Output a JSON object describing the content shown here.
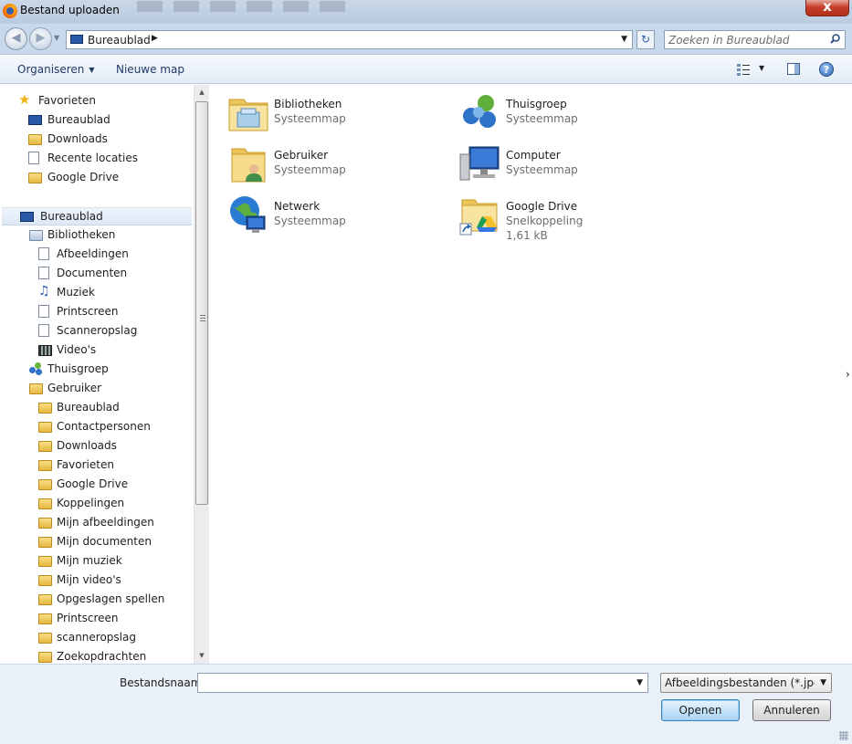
{
  "window": {
    "title": "Bestand uploaden",
    "close_label": "x"
  },
  "address": {
    "breadcrumb": "Bureaublad",
    "search_placeholder": "Zoeken in Bureaublad"
  },
  "toolbar": {
    "organize": "Organiseren",
    "new_folder": "Nieuwe map",
    "help": "?"
  },
  "nav": {
    "items": [
      {
        "label": "Favorieten",
        "icon": "star-icon",
        "level": 0
      },
      {
        "label": "Bureaublad",
        "icon": "desktop-icon",
        "level": 1
      },
      {
        "label": "Downloads",
        "icon": "downloads-folder-icon",
        "level": 1
      },
      {
        "label": "Recente locaties",
        "icon": "recent-places-icon",
        "level": 1
      },
      {
        "label": "Google Drive",
        "icon": "google-drive-folder-icon",
        "level": 1
      },
      {
        "label": "Bureaublad",
        "icon": "desktop-icon",
        "level": 0,
        "selected": true
      },
      {
        "label": "Bibliotheken",
        "icon": "libraries-icon",
        "level": 1
      },
      {
        "label": "Afbeeldingen",
        "icon": "pictures-icon",
        "level": 2
      },
      {
        "label": "Documenten",
        "icon": "documents-icon",
        "level": 2
      },
      {
        "label": "Muziek",
        "icon": "music-icon",
        "level": 2
      },
      {
        "label": "Printscreen",
        "icon": "library-icon",
        "level": 2
      },
      {
        "label": "Scanneropslag",
        "icon": "library-icon",
        "level": 2
      },
      {
        "label": "Video's",
        "icon": "videos-icon",
        "level": 2
      },
      {
        "label": "Thuisgroep",
        "icon": "homegroup-icon",
        "level": 1
      },
      {
        "label": "Gebruiker",
        "icon": "user-folder-icon",
        "level": 1
      },
      {
        "label": "Bureaublad",
        "icon": "folder-icon",
        "level": 2
      },
      {
        "label": "Contactpersonen",
        "icon": "folder-icon",
        "level": 2
      },
      {
        "label": "Downloads",
        "icon": "folder-icon",
        "level": 2
      },
      {
        "label": "Favorieten",
        "icon": "folder-icon",
        "level": 2
      },
      {
        "label": "Google Drive",
        "icon": "folder-icon",
        "level": 2
      },
      {
        "label": "Koppelingen",
        "icon": "folder-icon",
        "level": 2
      },
      {
        "label": "Mijn afbeeldingen",
        "icon": "folder-icon",
        "level": 2
      },
      {
        "label": "Mijn documenten",
        "icon": "folder-icon",
        "level": 2
      },
      {
        "label": "Mijn muziek",
        "icon": "folder-icon",
        "level": 2
      },
      {
        "label": "Mijn video's",
        "icon": "folder-icon",
        "level": 2
      },
      {
        "label": "Opgeslagen spellen",
        "icon": "folder-icon",
        "level": 2
      },
      {
        "label": "Printscreen",
        "icon": "folder-icon",
        "level": 2
      },
      {
        "label": "scanneropslag",
        "icon": "folder-icon",
        "level": 2
      },
      {
        "label": "Zoekopdrachten",
        "icon": "folder-icon",
        "level": 2
      }
    ]
  },
  "content": {
    "items": [
      {
        "name": "Bibliotheken",
        "type": "Systeemmap",
        "extra": "",
        "icon": "libraries-folder-icon"
      },
      {
        "name": "Thuisgroep",
        "type": "Systeemmap",
        "extra": "",
        "icon": "homegroup-icon"
      },
      {
        "name": "Gebruiker",
        "type": "Systeemmap",
        "extra": "",
        "icon": "user-folder-icon"
      },
      {
        "name": "Computer",
        "type": "Systeemmap",
        "extra": "",
        "icon": "computer-icon"
      },
      {
        "name": "Netwerk",
        "type": "Systeemmap",
        "extra": "",
        "icon": "network-icon"
      },
      {
        "name": "Google Drive",
        "type": "Snelkoppeling",
        "extra": "1,61 kB",
        "icon": "google-drive-shortcut-icon"
      }
    ]
  },
  "footer": {
    "filename_label": "Bestandsnaam:",
    "filename_value": "",
    "filter_value": "Afbeeldingsbestanden (*.jpe;*.jpg;*.jpeg;*.gif;*.png)",
    "open_label": "Openen",
    "cancel_label": "Annuleren"
  },
  "colors": {
    "titlebar": "#c9d6e6",
    "command_bar": "#e3ecf6",
    "selection": "#dde8f5",
    "close_button": "#c7402c",
    "footer": "#e9f0f8"
  }
}
